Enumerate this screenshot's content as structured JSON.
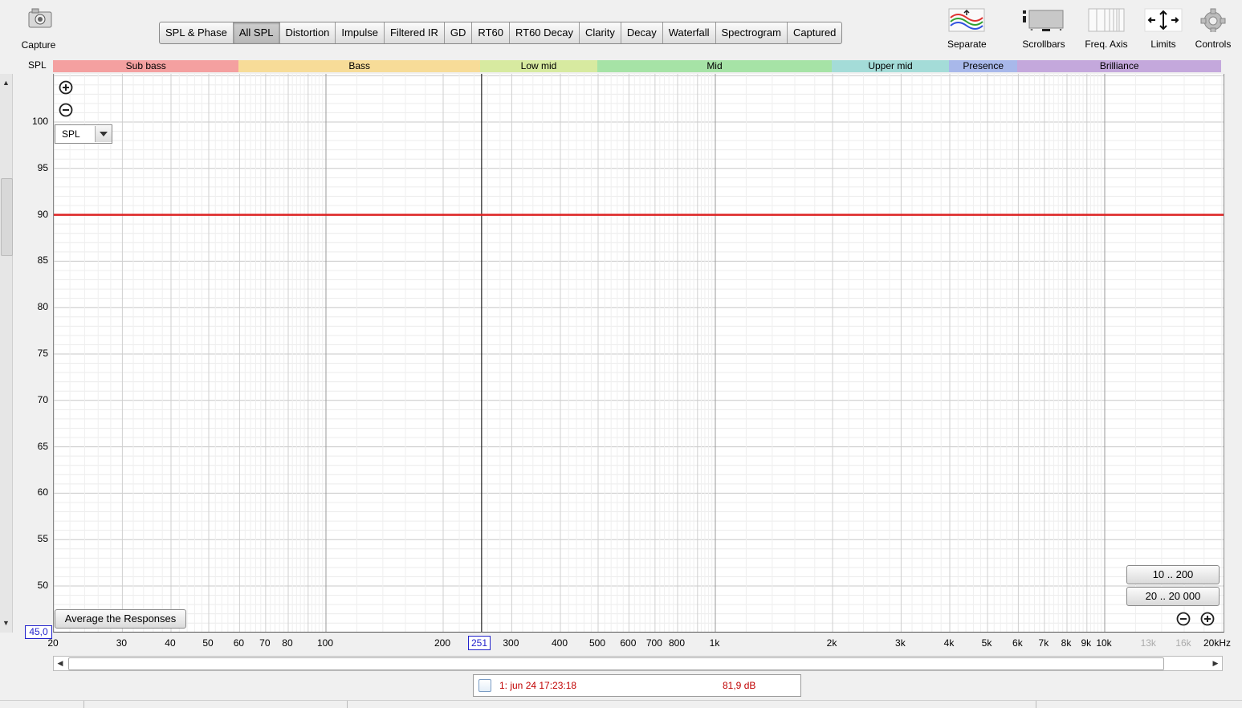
{
  "capture": {
    "label": "Capture",
    "icon": "camera-icon"
  },
  "tabs": [
    {
      "label": "SPL & Phase",
      "active": false
    },
    {
      "label": "All SPL",
      "active": true
    },
    {
      "label": "Distortion",
      "active": false
    },
    {
      "label": "Impulse",
      "active": false
    },
    {
      "label": "Filtered IR",
      "active": false
    },
    {
      "label": "GD",
      "active": false
    },
    {
      "label": "RT60",
      "active": false
    },
    {
      "label": "RT60 Decay",
      "active": false
    },
    {
      "label": "Clarity",
      "active": false
    },
    {
      "label": "Decay",
      "active": false
    },
    {
      "label": "Waterfall",
      "active": false
    },
    {
      "label": "Spectrogram",
      "active": false
    },
    {
      "label": "Captured",
      "active": false
    }
  ],
  "toolbar": {
    "separate": "Separate",
    "scrollbars": "Scrollbars",
    "freq_axis": "Freq. Axis",
    "limits": "Limits",
    "controls": "Controls"
  },
  "graph": {
    "y_axis_title": "SPL",
    "y_ticks": [
      "100",
      "95",
      "90",
      "85",
      "80",
      "75",
      "70",
      "65",
      "60",
      "55",
      "50"
    ],
    "x_ticks": [
      "20",
      "30",
      "40",
      "50",
      "60",
      "70",
      "80",
      "100",
      "200",
      "300",
      "400",
      "500",
      "600",
      "700",
      "800",
      "1k",
      "2k",
      "3k",
      "4k",
      "5k",
      "6k",
      "7k",
      "8k",
      "9k",
      "10k",
      "13k",
      "16k",
      "20kHz"
    ],
    "bands": [
      {
        "label": "Sub bass",
        "color": "#f4a0a0"
      },
      {
        "label": "Bass",
        "color": "#f7dc98"
      },
      {
        "label": "Low mid",
        "color": "#d7eaa0"
      },
      {
        "label": "Mid",
        "color": "#a6e3a6"
      },
      {
        "label": "Upper mid",
        "color": "#a4dcd8"
      },
      {
        "label": "Presence",
        "color": "#a8b8ea"
      },
      {
        "label": "Brilliance",
        "color": "#c4a8dc"
      }
    ],
    "cursor_x_value": "251",
    "cursor_y_value": "45,0",
    "trace_color": "#dd2222",
    "trace_spl": 90,
    "selector_value": "SPL"
  },
  "buttons": {
    "average": "Average the Responses",
    "range_low": "10 .. 200",
    "range_full": "20 .. 20 000"
  },
  "legend": {
    "name": "1: jun 24 17:23:18",
    "value": "81,9 dB"
  }
}
